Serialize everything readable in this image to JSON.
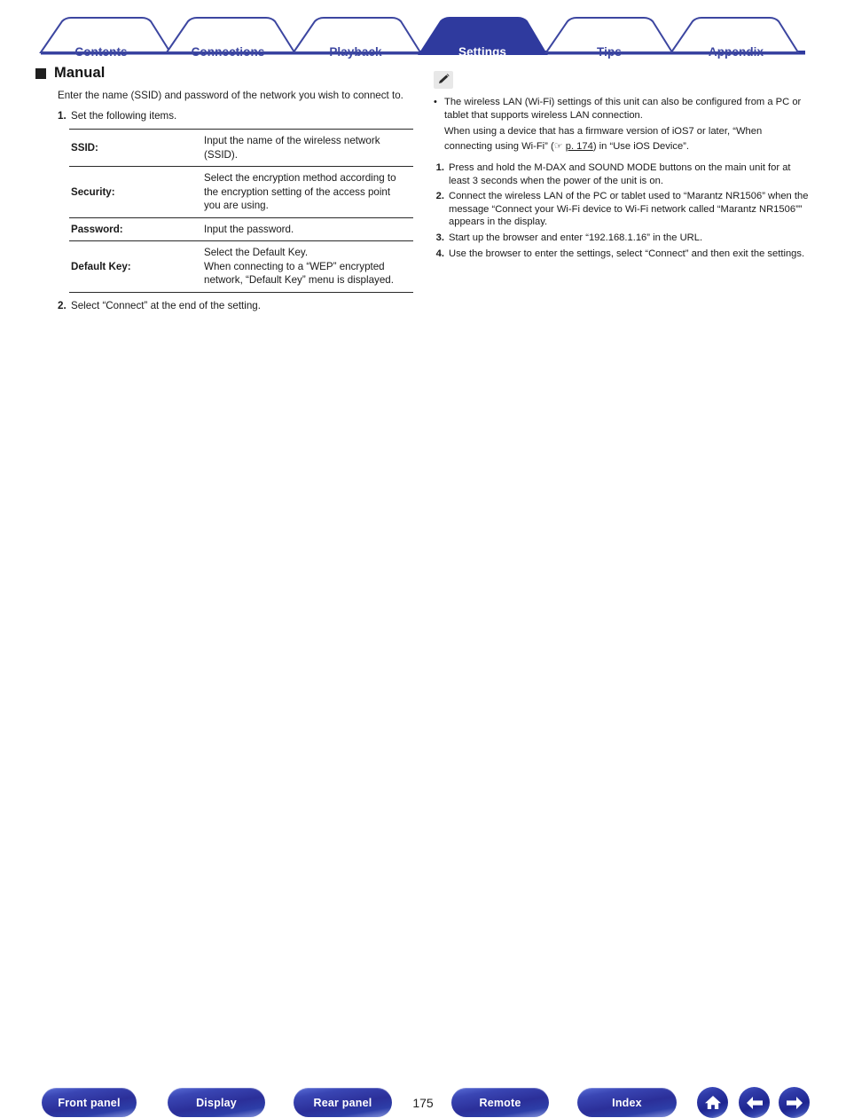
{
  "tabs": [
    {
      "label": "Contents",
      "active": false
    },
    {
      "label": "Connections",
      "active": false
    },
    {
      "label": "Playback",
      "active": false
    },
    {
      "label": "Settings",
      "active": true
    },
    {
      "label": "Tips",
      "active": false
    },
    {
      "label": "Appendix",
      "active": false
    }
  ],
  "colors": {
    "tab_border": "#3c46a0",
    "tab_active_bg": "#2f3a9e",
    "tab_text": "#3c46a0",
    "tab_active_text": "#ffffff",
    "button_blue": "#2b2f99",
    "body_text": "#1f1f1f"
  },
  "left": {
    "heading": "Manual",
    "intro": "Enter the name (SSID) and password of the network you wish to connect to.",
    "steps": [
      {
        "num": "1.",
        "text": "Set the following items."
      },
      {
        "num": "2.",
        "text": "Select “Connect” at the end of the setting."
      }
    ],
    "table": {
      "rows": [
        {
          "key": "SSID:",
          "value": "Input the name of the wireless network (SSID)."
        },
        {
          "key": "Security:",
          "value": "Select the encryption method according to the encryption setting of the access point you are using."
        },
        {
          "key": "Password:",
          "value": "Input the password."
        },
        {
          "key": "Default Key:",
          "value": "Select the Default Key.\nWhen connecting to a “WEP” encrypted network, “Default Key” menu is displayed."
        }
      ]
    }
  },
  "right": {
    "note_icon": "pencil-note-icon",
    "bullet_marker": "•",
    "bullet_text": "The wireless LAN (Wi-Fi) settings of this unit can also be configured from a PC or tablet that supports wireless LAN connection.",
    "sub_para_before": "When using a device that has a firmware version of iOS7 or later, “When connecting using Wi-Fi” (",
    "hand_glyph": "☞",
    "page_link": "p. 174",
    "sub_para_after": ") in “Use iOS Device”.",
    "steps": [
      {
        "num": "1.",
        "text": "Press and hold the M-DAX and SOUND MODE buttons on the main unit for at least 3 seconds when the power of the unit is on."
      },
      {
        "num": "2.",
        "text": "Connect the wireless LAN of the PC or tablet used to “Marantz NR1506” when the message “Connect your Wi-Fi device to Wi-Fi network called “Marantz NR1506”” appears in the display."
      },
      {
        "num": "3.",
        "text": "Start up the browser and enter “192.168.1.16” in the URL."
      },
      {
        "num": "4.",
        "text": "Use the browser to enter the settings, select “Connect” and then exit the settings."
      }
    ]
  },
  "bottom": {
    "buttons": [
      {
        "label": "Front panel"
      },
      {
        "label": "Display"
      },
      {
        "label": "Rear panel"
      },
      {
        "label": "Remote"
      },
      {
        "label": "Index"
      }
    ],
    "page_number": "175",
    "icons": [
      {
        "name": "home-icon"
      },
      {
        "name": "arrow-left-icon"
      },
      {
        "name": "arrow-right-icon"
      }
    ]
  }
}
